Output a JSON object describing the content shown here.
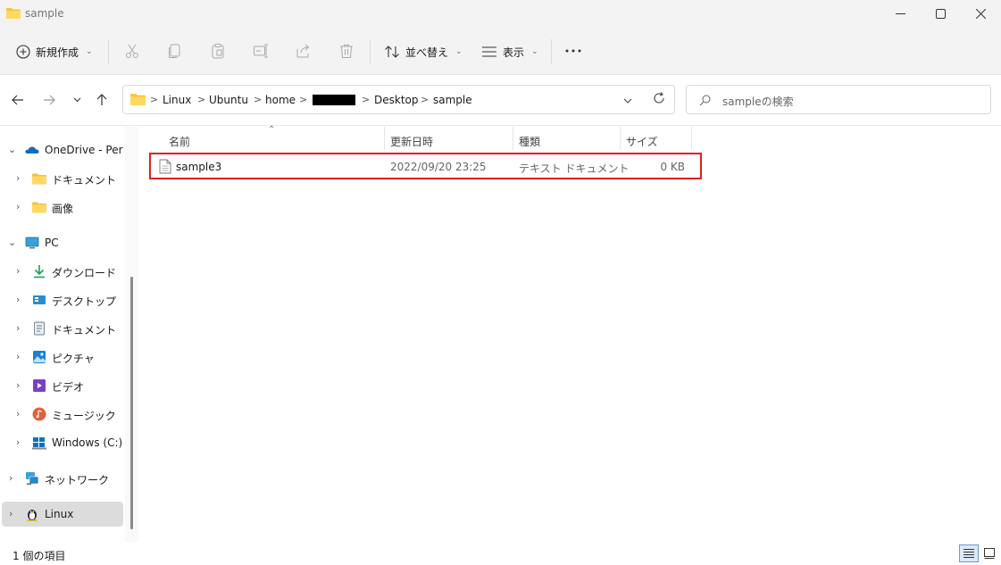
{
  "window": {
    "title": "sample",
    "minimize_icon": "minimize-icon",
    "maximize_icon": "maximize-icon",
    "close_icon": "close-icon"
  },
  "commandbar": {
    "new_label": "新規作成",
    "sort_label": "並べ替え",
    "view_label": "表示",
    "more_label": "···",
    "icons": [
      "plus-circle-icon",
      "cut-icon",
      "copy-icon",
      "paste-icon",
      "rename-icon",
      "share-icon",
      "delete-icon",
      "sort-icon",
      "view-icon",
      "more-icon"
    ]
  },
  "address": {
    "crumbs": [
      "Linux",
      "Ubuntu",
      "home",
      "Desktop",
      "sample"
    ],
    "separator": ">",
    "search_placeholder": "sampleの検索"
  },
  "sidebar": {
    "items": [
      {
        "label": "OneDrive - Personal",
        "icon": "onedrive-icon",
        "expanded": true
      },
      {
        "label": "ドキュメント",
        "icon": "folder-icon"
      },
      {
        "label": "画像",
        "icon": "folder-icon"
      },
      {
        "label": "PC",
        "icon": "pc-icon",
        "expanded": true
      },
      {
        "label": "ダウンロード",
        "icon": "download-icon"
      },
      {
        "label": "デスクトップ",
        "icon": "desktop-icon"
      },
      {
        "label": "ドキュメント",
        "icon": "document-icon"
      },
      {
        "label": "ピクチャ",
        "icon": "picture-icon"
      },
      {
        "label": "ビデオ",
        "icon": "video-icon"
      },
      {
        "label": "ミュージック",
        "icon": "music-icon"
      },
      {
        "label": "Windows (C:)",
        "icon": "drive-icon"
      },
      {
        "label": "ネットワーク",
        "icon": "network-icon"
      },
      {
        "label": "Linux",
        "icon": "linux-icon",
        "selected": true
      }
    ]
  },
  "filelist": {
    "columns": [
      "名前",
      "更新日時",
      "種類",
      "サイズ"
    ],
    "rows": [
      {
        "name": "sample3",
        "modified": "2022/09/20 23:25",
        "type": "テキスト ドキュメント",
        "size": "0 KB",
        "icon": "text-file-icon"
      }
    ]
  },
  "status": {
    "count_text": "1 個の項目",
    "details_view_icon": "details-view-icon",
    "tiles_view_icon": "large-icons-view-icon"
  },
  "colors": {
    "accent": "#0067c0",
    "highlight_border": "#e02020",
    "chrome_bg": "#f3f3f3",
    "selected_bg": "#dcdcdc"
  }
}
